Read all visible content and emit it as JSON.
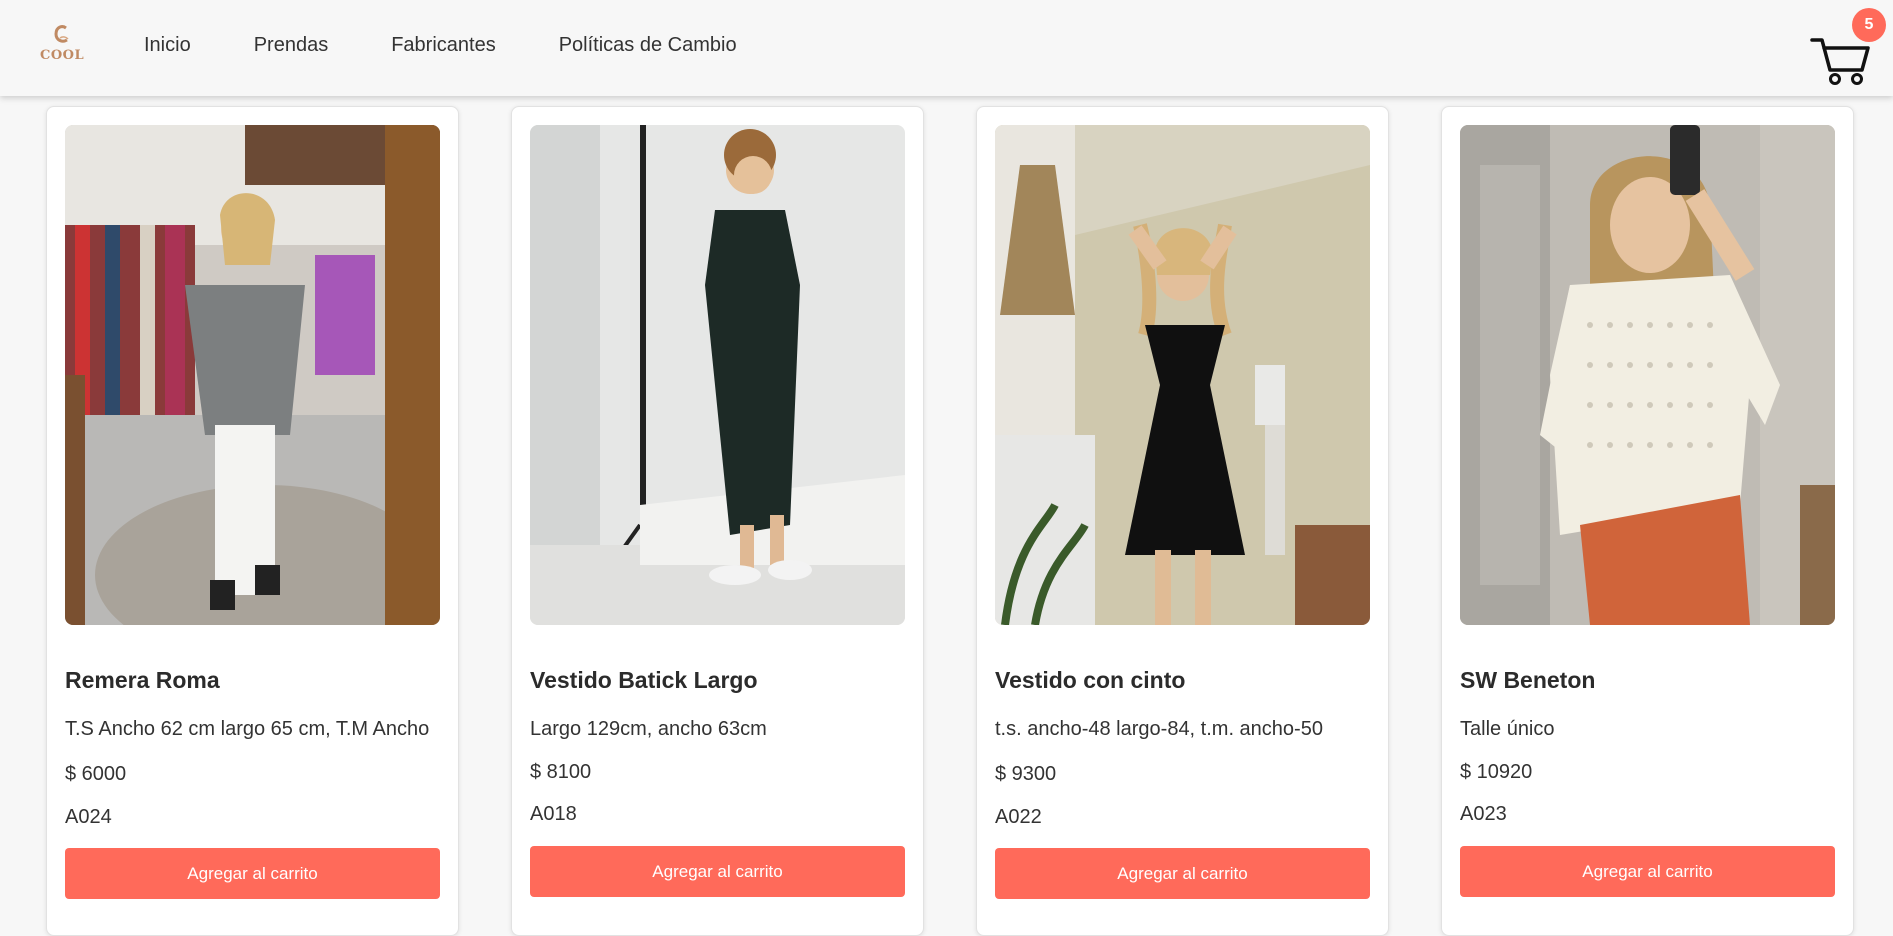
{
  "header": {
    "logo_text": "COOL",
    "nav": [
      "Inicio",
      "Prendas",
      "Fabricantes",
      "Políticas de Cambio"
    ],
    "cart_count": "5"
  },
  "products": [
    {
      "title": "Remera Roma",
      "description": "T.S Ancho 62 cm largo 65 cm, T.M Ancho",
      "price": "$ 6000",
      "code": "A024",
      "button": "Agregar al carrito"
    },
    {
      "title": "Vestido Batick Largo",
      "description": "Largo 129cm, ancho 63cm",
      "price": "$ 8100",
      "code": "A018",
      "button": "Agregar al carrito"
    },
    {
      "title": "Vestido con cinto",
      "description": "t.s. ancho-48 largo-84, t.m. ancho-50",
      "price": "$ 9300",
      "code": "A022",
      "button": "Agregar al carrito"
    },
    {
      "title": "SW Beneton",
      "description": "Talle único",
      "price": "$ 10920",
      "code": "A023",
      "button": "Agregar al carrito"
    }
  ],
  "colors": {
    "accent": "#ff6a5a",
    "logo": "#c08a63"
  }
}
